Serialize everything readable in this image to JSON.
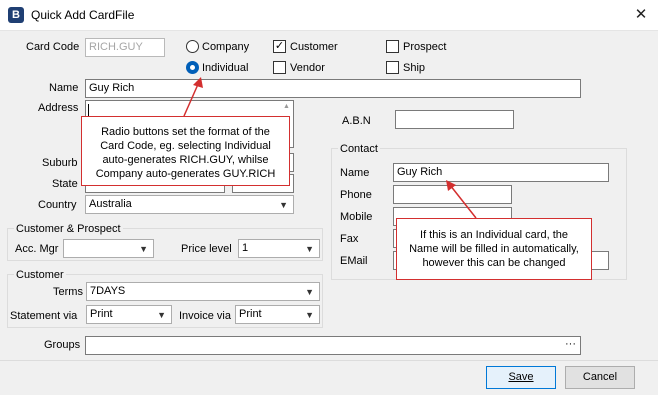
{
  "window": {
    "title": "Quick Add CardFile",
    "close_glyph": "✕",
    "app_icon_glyph": "B"
  },
  "card_code": {
    "label": "Card Code",
    "value": "RICH.GUY"
  },
  "card_format": {
    "company_label": "Company",
    "individual_label": "Individual",
    "selected": "Individual"
  },
  "card_types": [
    {
      "label": "Customer",
      "checked": true
    },
    {
      "label": "Vendor",
      "checked": false
    },
    {
      "label": "Prospect",
      "checked": false
    },
    {
      "label": "Ship",
      "checked": false
    }
  ],
  "name": {
    "label": "Name",
    "value": "Guy Rich"
  },
  "address": {
    "label": "Address",
    "value": ""
  },
  "suburb": {
    "label": "Suburb"
  },
  "state": {
    "label": "State"
  },
  "country": {
    "label": "Country",
    "value": "Australia"
  },
  "abn": {
    "label": "A.B.N",
    "value": ""
  },
  "contact": {
    "group_label": "Contact",
    "name_label": "Name",
    "name_value": "Guy Rich",
    "phone_label": "Phone",
    "mobile_label": "Mobile",
    "fax_label": "Fax",
    "email_label": "EMail"
  },
  "customer_prospect": {
    "group_label": "Customer & Prospect",
    "acc_mgr_label": "Acc. Mgr",
    "acc_mgr_value": "",
    "price_level_label": "Price level",
    "price_level_value": "1"
  },
  "customer": {
    "group_label": "Customer",
    "terms_label": "Terms",
    "terms_value": "7DAYS",
    "statement_label": "Statement via",
    "statement_value": "Print",
    "invoice_label": "Invoice via",
    "invoice_value": "Print"
  },
  "groups": {
    "label": "Groups",
    "ellipsis": "···"
  },
  "buttons": {
    "save": "Save",
    "cancel": "Cancel"
  },
  "callouts": {
    "radio": "Radio buttons set the format of the Card Code, eg. selecting Individual auto-generates RICH.GUY, whilse Company auto-generates GUY.RICH",
    "contact": "If this is an Individual card, the Name will be filled in automatically, however this can be changed"
  },
  "icons": {
    "dropdown": "chevron-down-icon",
    "check": "checkmark-icon"
  },
  "colors": {
    "callout_border": "#d32f2f",
    "radio_selected": "#005fb8",
    "default_button_border": "#0078d7"
  }
}
